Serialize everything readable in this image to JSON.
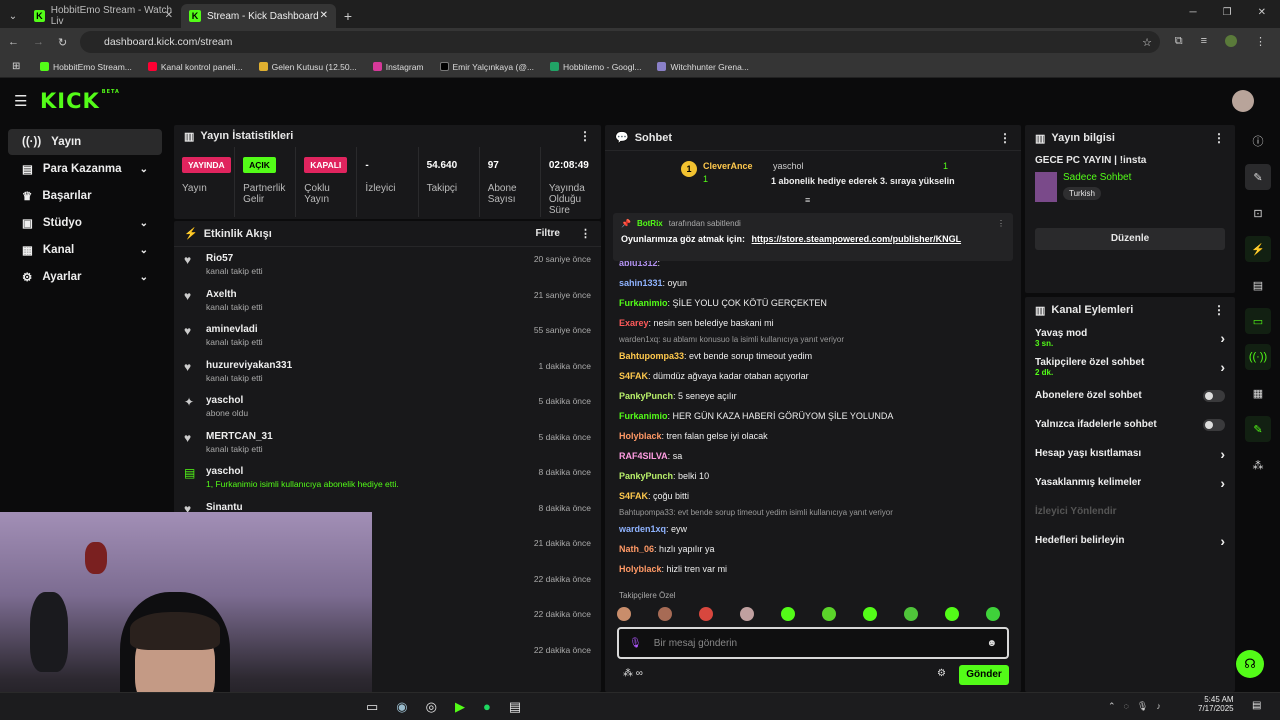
{
  "browser": {
    "tabs": [
      {
        "title": "HobbitEmo Stream - Watch Liv"
      },
      {
        "title": "Stream - Kick Dashboard"
      }
    ],
    "url": "dashboard.kick.com/stream",
    "bookmarks": [
      "HobbitEmo Stream...",
      "Kanal kontrol paneli...",
      "Gelen Kutusu (12.50...",
      "Instagram",
      "Emir Yalçınkaya (@...",
      "Hobbitemo - Googl...",
      "Witchhunter Grena..."
    ]
  },
  "logo": "KICK",
  "logo_sup": "BETA",
  "sidebar": {
    "items": [
      {
        "label": "Yayın",
        "icon": "broadcast-icon",
        "chev": ""
      },
      {
        "label": "Para Kazanma",
        "icon": "money-icon",
        "chev": "⌄"
      },
      {
        "label": "Başarılar",
        "icon": "trophy-icon",
        "chev": ""
      },
      {
        "label": "Stüdyo",
        "icon": "studio-icon",
        "chev": "⌄"
      },
      {
        "label": "Kanal",
        "icon": "channel-icon",
        "chev": "⌄"
      },
      {
        "label": "Ayarlar",
        "icon": "settings-icon",
        "chev": "⌄"
      }
    ]
  },
  "stats": {
    "title": "Yayın İstatistikleri",
    "items": [
      {
        "value": "YAYINDA",
        "label": "Yayın"
      },
      {
        "value": "AÇIK",
        "label": "Partnerlik Gelir"
      },
      {
        "value": "KAPALI",
        "label": "Çoklu Yayın"
      },
      {
        "value": "-",
        "label": "İzleyici"
      },
      {
        "value": "54.640",
        "label": "Takipçi"
      },
      {
        "value": "97",
        "label": "Abone Sayısı"
      },
      {
        "value": "02:08:49",
        "label": "Yayında Olduğu Süre"
      }
    ]
  },
  "activity": {
    "title": "Etkinlik Akışı",
    "filter": "Filtre",
    "rows": [
      {
        "name": "Rio57",
        "sub": "kanalı takip etti",
        "time": "20 saniye önce"
      },
      {
        "name": "Axelth",
        "sub": "kanalı takip etti",
        "time": "21 saniye önce"
      },
      {
        "name": "aminevladi",
        "sub": "kanalı takip etti",
        "time": "55 saniye önce"
      },
      {
        "name": "huzureviyakan331",
        "sub": "kanalı takip etti",
        "time": "1 dakika önce"
      },
      {
        "name": "yaschol",
        "sub": "abone oldu",
        "time": "5 dakika önce"
      },
      {
        "name": "MERTCAN_31",
        "sub": "kanalı takip etti",
        "time": "5 dakika önce"
      },
      {
        "name": "yaschol",
        "sub": "1, Furkanimio isimli kullanıcıya abonelik hediye etti.",
        "time": "8 dakika önce"
      },
      {
        "name": "Sinantu",
        "sub": "",
        "time": "8 dakika önce"
      },
      {
        "name": "",
        "sub": "",
        "time": "21 dakika önce"
      },
      {
        "name": "",
        "sub": "",
        "time": "22 dakika önce"
      },
      {
        "name": "",
        "sub": "",
        "time": "22 dakika önce"
      },
      {
        "name": "",
        "sub": "",
        "time": "22 dakika önce"
      }
    ]
  },
  "chat": {
    "title": "Sohbet",
    "gift_top": {
      "user": "CleverAnce",
      "count": "1",
      "rank": "1",
      "user2": "yaschol",
      "count2": "1",
      "msg": "1 abonelik hediye ederek 3. sıraya yükselin"
    },
    "pinned": {
      "by": "BotRix",
      "by_suffix": "tarafından sabitlendi",
      "text": "Oyunlarımıza göz atmak için:",
      "link": "https://store.steampowered.com/publisher/KNGL"
    },
    "messages": [
      {
        "user": "abiu1312",
        "color": "#b392f0",
        "text": ""
      },
      {
        "user": "sahin1331",
        "color": "#8fb3ff",
        "text": "oyun"
      },
      {
        "user": "Furkanimio",
        "color": "#53fc18",
        "text": "ŞİLE YOLU ÇOK KÖTÜ GERÇEKTEN"
      },
      {
        "user": "Exarey",
        "color": "#ff5a5a",
        "text": "nesin sen belediye baskani mi"
      },
      {
        "reply": "warden1xq: su ablamı konusuo la isimli kullanıcıya yanıt veriyor"
      },
      {
        "user": "Bahtupompa33",
        "color": "#ffc94d",
        "text": "evt bende sorup timeout yedim"
      },
      {
        "user": "S4FAK",
        "color": "#ffc94d",
        "text": "dümdüz ağvaya kadar otaban açıyorlar"
      },
      {
        "user": "PankyPunch",
        "color": "#b8f06a",
        "text": "5 seneye açılır"
      },
      {
        "user": "Furkanimio",
        "color": "#53fc18",
        "text": "HER GÜN KAZA HABERİ GÖRÜYOM ŞİLE YOLUNDA"
      },
      {
        "user": "Holyblack",
        "color": "#ff9966",
        "text": "tren falan gelse iyi olacak"
      },
      {
        "user": "RAF4SILVA",
        "color": "#ff9de2",
        "text": "sa"
      },
      {
        "user": "PankyPunch",
        "color": "#b8f06a",
        "text": "belki 10"
      },
      {
        "user": "S4FAK",
        "color": "#ffc94d",
        "text": "çoğu bitti"
      },
      {
        "reply": "Bahtupompa33: evt bende sorup timeout yedim isimli kullanıcıya yanıt veriyor"
      },
      {
        "user": "warden1xq",
        "color": "#8fb3ff",
        "text": "eyw"
      },
      {
        "user": "Nath_06",
        "color": "#ff9966",
        "text": "hızlı yapılır ya"
      },
      {
        "user": "Holyblack",
        "color": "#ff9966",
        "text": "hizli tren var mi"
      }
    ],
    "emote_label": "Takipçilere Özel",
    "placeholder": "Bir mesaj gönderin",
    "send": "Gönder"
  },
  "stream_info": {
    "title": "Yayın bilgisi",
    "stream_title": "GECE PC YAYIN | !insta",
    "category": "Sadece Sohbet",
    "tag": "Turkish",
    "edit": "Düzenle"
  },
  "channel_actions": {
    "title": "Kanal Eylemleri",
    "rows": [
      {
        "label": "Yavaş mod",
        "sub": "3 sn.",
        "type": "arrow"
      },
      {
        "label": "Takipçilere özel sohbet",
        "sub": "2 dk.",
        "type": "arrow"
      },
      {
        "label": "Abonelere özel sohbet",
        "sub": "",
        "type": "toggle"
      },
      {
        "label": "Yalnızca ifadelerle sohbet",
        "sub": "",
        "type": "toggle"
      },
      {
        "label": "Hesap yaşı kısıtlaması",
        "sub": "",
        "type": "arrow"
      },
      {
        "label": "Yasaklanmış kelimeler",
        "sub": "",
        "type": "arrow"
      },
      {
        "label": "İzleyici Yönlendir",
        "sub": "",
        "type": "disabled"
      },
      {
        "label": "Hedefleri belirleyin",
        "sub": "",
        "type": "arrow"
      }
    ]
  },
  "taskbar": {
    "time": "5:45 AM",
    "date": "7/17/2025"
  }
}
